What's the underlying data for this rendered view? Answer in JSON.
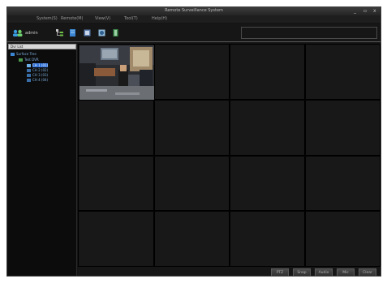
{
  "window": {
    "title": "Remote Surveillance System",
    "controls": {
      "minimize": "_",
      "restore": "▫",
      "close": "x"
    }
  },
  "menu": [
    "System(S)",
    "Remote(M)",
    "View(V)",
    "Tool(T)",
    "Help(H)"
  ],
  "toolbar": {
    "user": "admin",
    "icons": [
      "admin-icon",
      "device-tree-icon",
      "device-icon",
      "record-icon",
      "playback-icon",
      "exit-icon"
    ]
  },
  "sidebar": {
    "header": "Dvr List",
    "tree": [
      {
        "label": "Surface Tree",
        "indent": 0,
        "selected": false
      },
      {
        "label": "Test DVR",
        "indent": 1,
        "selected": false
      },
      {
        "label": "CH 1 (01)",
        "indent": 2,
        "selected": true
      },
      {
        "label": "CH 2 (02)",
        "indent": 2,
        "selected": false
      },
      {
        "label": "CH 3 (03)",
        "indent": 2,
        "selected": false
      },
      {
        "label": "CH 4 (04)",
        "indent": 2,
        "selected": false
      }
    ]
  },
  "grid": {
    "rows": 4,
    "cols": 4,
    "active_cell": 0
  },
  "buttons": [
    "PTZ",
    "Snap",
    "Audio",
    "Mic",
    "Clear"
  ],
  "colors": {
    "accent": "#2c6ed8",
    "background": "#141414",
    "grid_line": "#000000"
  }
}
